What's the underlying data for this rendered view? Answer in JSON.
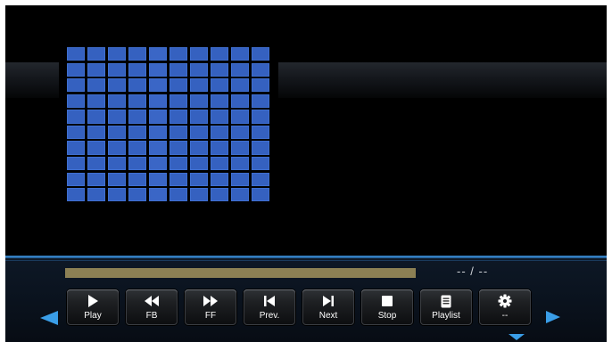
{
  "player": {
    "time_display": "-- / --",
    "progress_fraction": 0.0
  },
  "controls": [
    {
      "id": "play",
      "label": "Play",
      "icon": "play-icon"
    },
    {
      "id": "fb",
      "label": "FB",
      "icon": "fast-backward-icon"
    },
    {
      "id": "ff",
      "label": "FF",
      "icon": "fast-forward-icon"
    },
    {
      "id": "prev",
      "label": "Prev.",
      "icon": "skip-previous-icon"
    },
    {
      "id": "next",
      "label": "Next",
      "icon": "skip-next-icon"
    },
    {
      "id": "stop",
      "label": "Stop",
      "icon": "stop-icon"
    },
    {
      "id": "playlist",
      "label": "Playlist",
      "icon": "playlist-icon"
    },
    {
      "id": "settings",
      "label": "--",
      "icon": "gear-icon"
    }
  ],
  "colors": {
    "accent": "#3a9ee8",
    "thumbnail_tile": "#3561c0",
    "progress_bar": "#8c8054"
  }
}
